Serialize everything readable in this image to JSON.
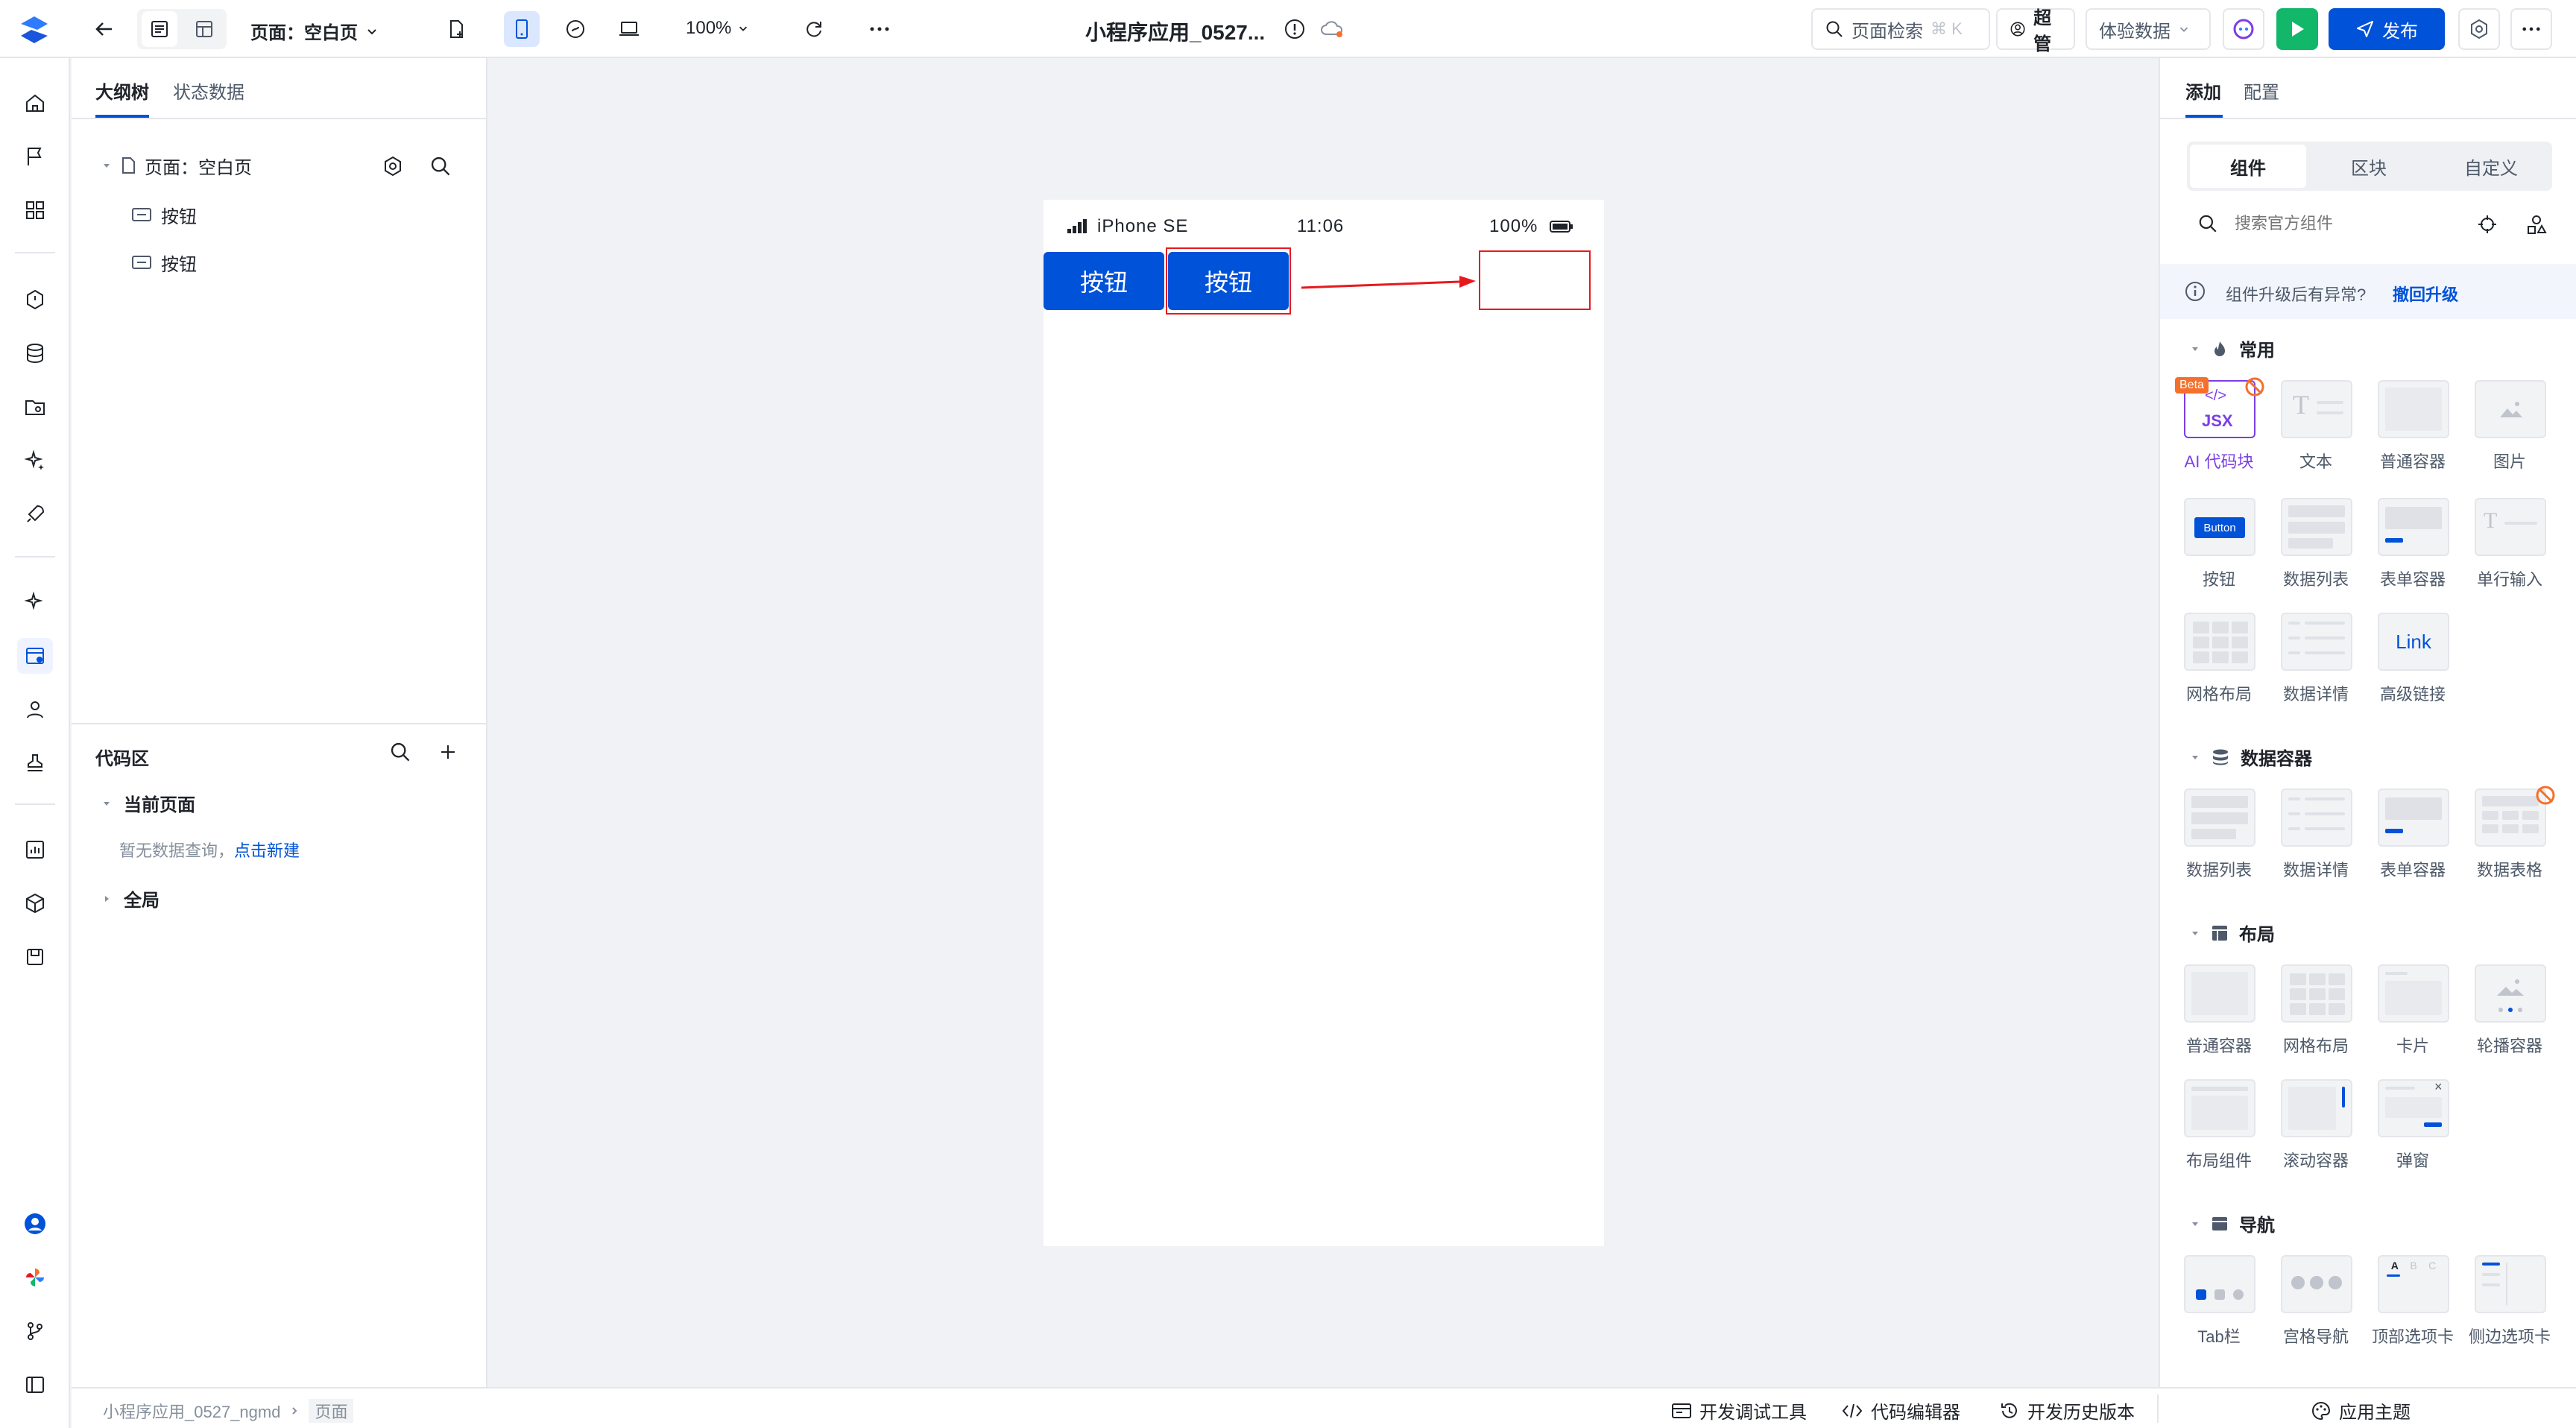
{
  "topbar": {
    "page_label": "页面：空白页",
    "zoom": "100%",
    "app_title": "小程序应用_0527...",
    "search_label": "页面检索",
    "search_shortcut": "⌘ K",
    "user_role": "超管",
    "data_select": "体验数据",
    "publish_label": "发布"
  },
  "outline": {
    "tabs": [
      "大纲树",
      "状态数据"
    ],
    "root_label": "页面：空白页",
    "items": [
      "按钮",
      "按钮"
    ]
  },
  "code": {
    "title": "代码区",
    "current_page": "当前页面",
    "empty_text": "暂无数据查询，",
    "create_link": "点击新建",
    "global": "全局"
  },
  "phone": {
    "device": "iPhone SE",
    "time": "11:06",
    "battery": "100%",
    "buttons": [
      "按钮",
      "按钮"
    ]
  },
  "right": {
    "tabs": [
      "添加",
      "配置"
    ],
    "segments": [
      "组件",
      "区块",
      "自定义"
    ],
    "search_placeholder": "搜索官方组件",
    "notice": "组件升级后有异常?",
    "notice_link": "撤回升级",
    "sections": {
      "common": {
        "title": "常用",
        "items": [
          "AI 代码块",
          "文本",
          "普通容器",
          "图片",
          "按钮",
          "数据列表",
          "表单容器",
          "单行输入",
          "网格布局",
          "数据详情",
          "高级链接"
        ]
      },
      "data": {
        "title": "数据容器",
        "items": [
          "数据列表",
          "数据详情",
          "表单容器",
          "数据表格"
        ]
      },
      "layout": {
        "title": "布局",
        "items": [
          "普通容器",
          "网格布局",
          "卡片",
          "轮播容器",
          "布局组件",
          "滚动容器",
          "弹窗"
        ]
      },
      "nav": {
        "title": "导航",
        "items": [
          "Tab栏",
          "宫格导航",
          "顶部选项卡",
          "侧边选项卡"
        ]
      }
    },
    "thumb_text": {
      "beta": "Beta",
      "jsx": "JSX",
      "button": "Button",
      "link": "Link"
    }
  },
  "bottombar": {
    "breadcrumb": [
      "小程序应用_0527_ngmd",
      "页面"
    ],
    "dev_tools": "开发调试工具",
    "code_editor": "代码编辑器",
    "history": "开发历史版本",
    "theme": "应用主题"
  },
  "colors": {
    "primary": "#0052d9",
    "annotation": "#e8191d",
    "ai_purple": "#7b3fe4",
    "run_green": "#12b76a"
  }
}
